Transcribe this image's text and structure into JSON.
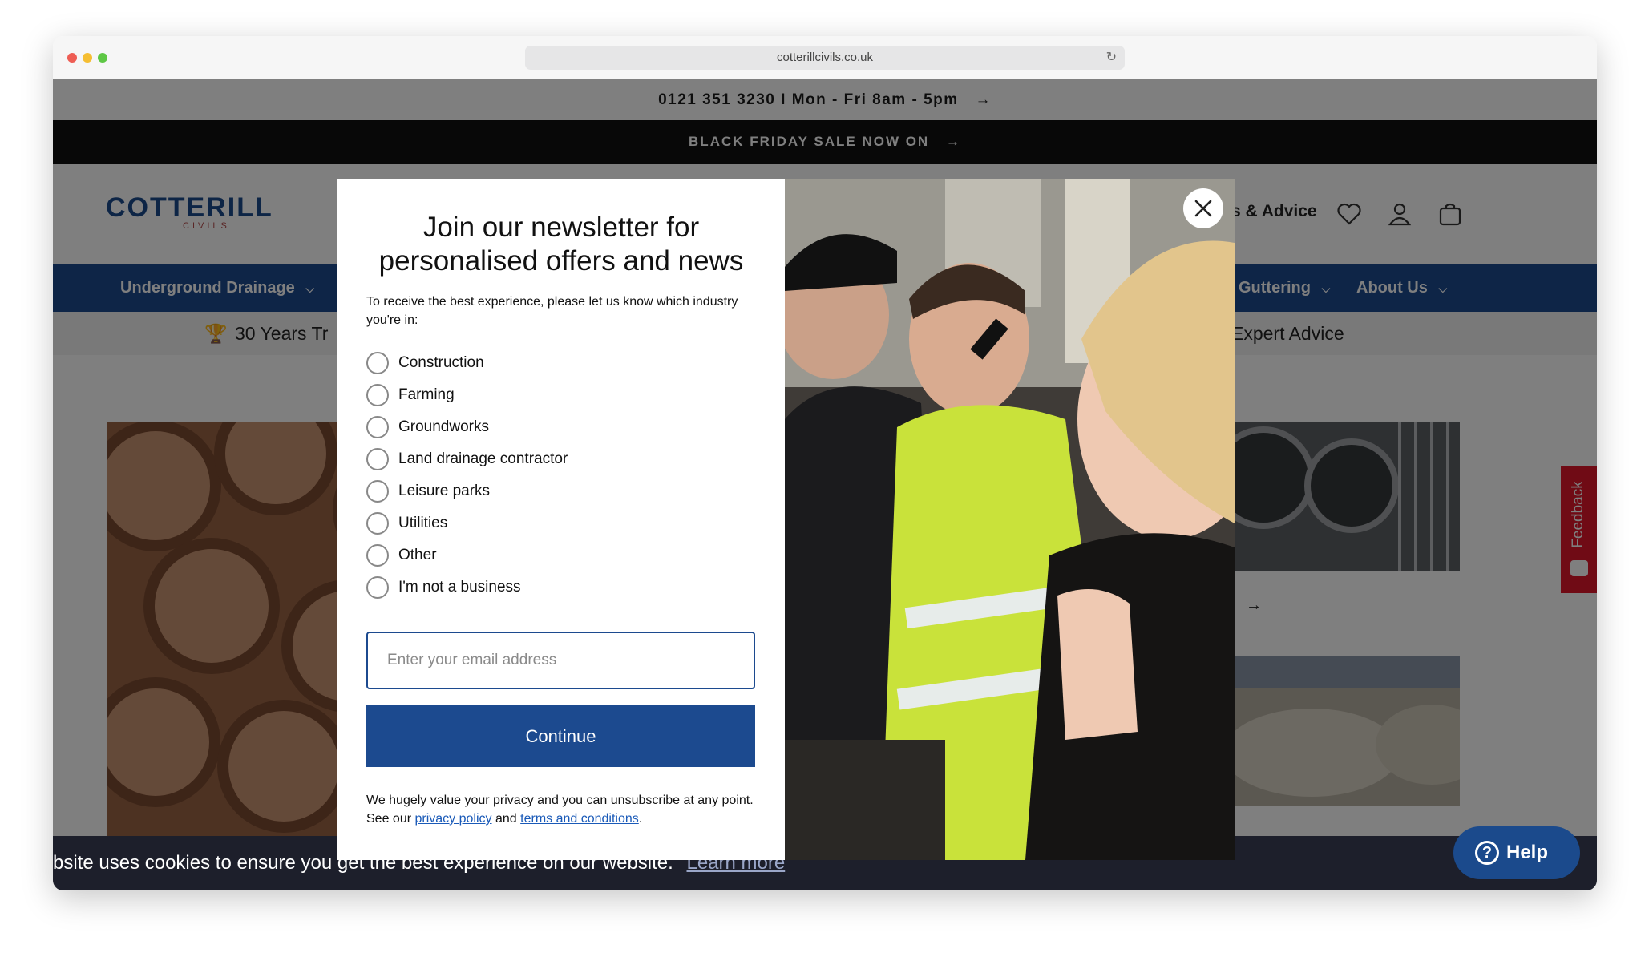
{
  "browser": {
    "url": "cotterillcivils.co.uk",
    "traffic_lights": [
      "#ee5d54",
      "#f5be32",
      "#5ec745"
    ]
  },
  "site": {
    "topbar_text": "0121 351 3230 I Mon - Fri 8am - 5pm",
    "announcement": "BLACK FRIDAY SALE NOW ON",
    "logo_text": "COTTERILL",
    "logo_sub": "CIVILS",
    "header_link": "s & Advice",
    "nav": [
      "Underground Drainage",
      "Guttering",
      "About Us"
    ],
    "usp_left": "30 Years Tr",
    "usp_right": "Expert Advice",
    "feedback_label": "Feedback",
    "help_label": "Help",
    "cookie_text": "bsite uses cookies to ensure you get the best experience on our website.",
    "cookie_link": "Learn more",
    "accent_color": "#1c4a8f"
  },
  "modal": {
    "title": "Join our newsletter for personalised offers and news",
    "subtitle": "To receive the best experience, please let us know which industry you're in:",
    "options": [
      "Construction",
      "Farming",
      "Groundworks",
      "Land drainage contractor",
      "Leisure parks",
      "Utilities",
      "Other",
      "I'm not a business"
    ],
    "email_placeholder": "Enter your email address",
    "email_value": "",
    "continue_label": "Continue",
    "legal_prefix": "We hugely value your privacy and you can unsubscribe at any point. See our",
    "privacy_link": "privacy policy",
    "legal_and": "and",
    "terms_link": "terms and conditions",
    "legal_suffix": "."
  }
}
